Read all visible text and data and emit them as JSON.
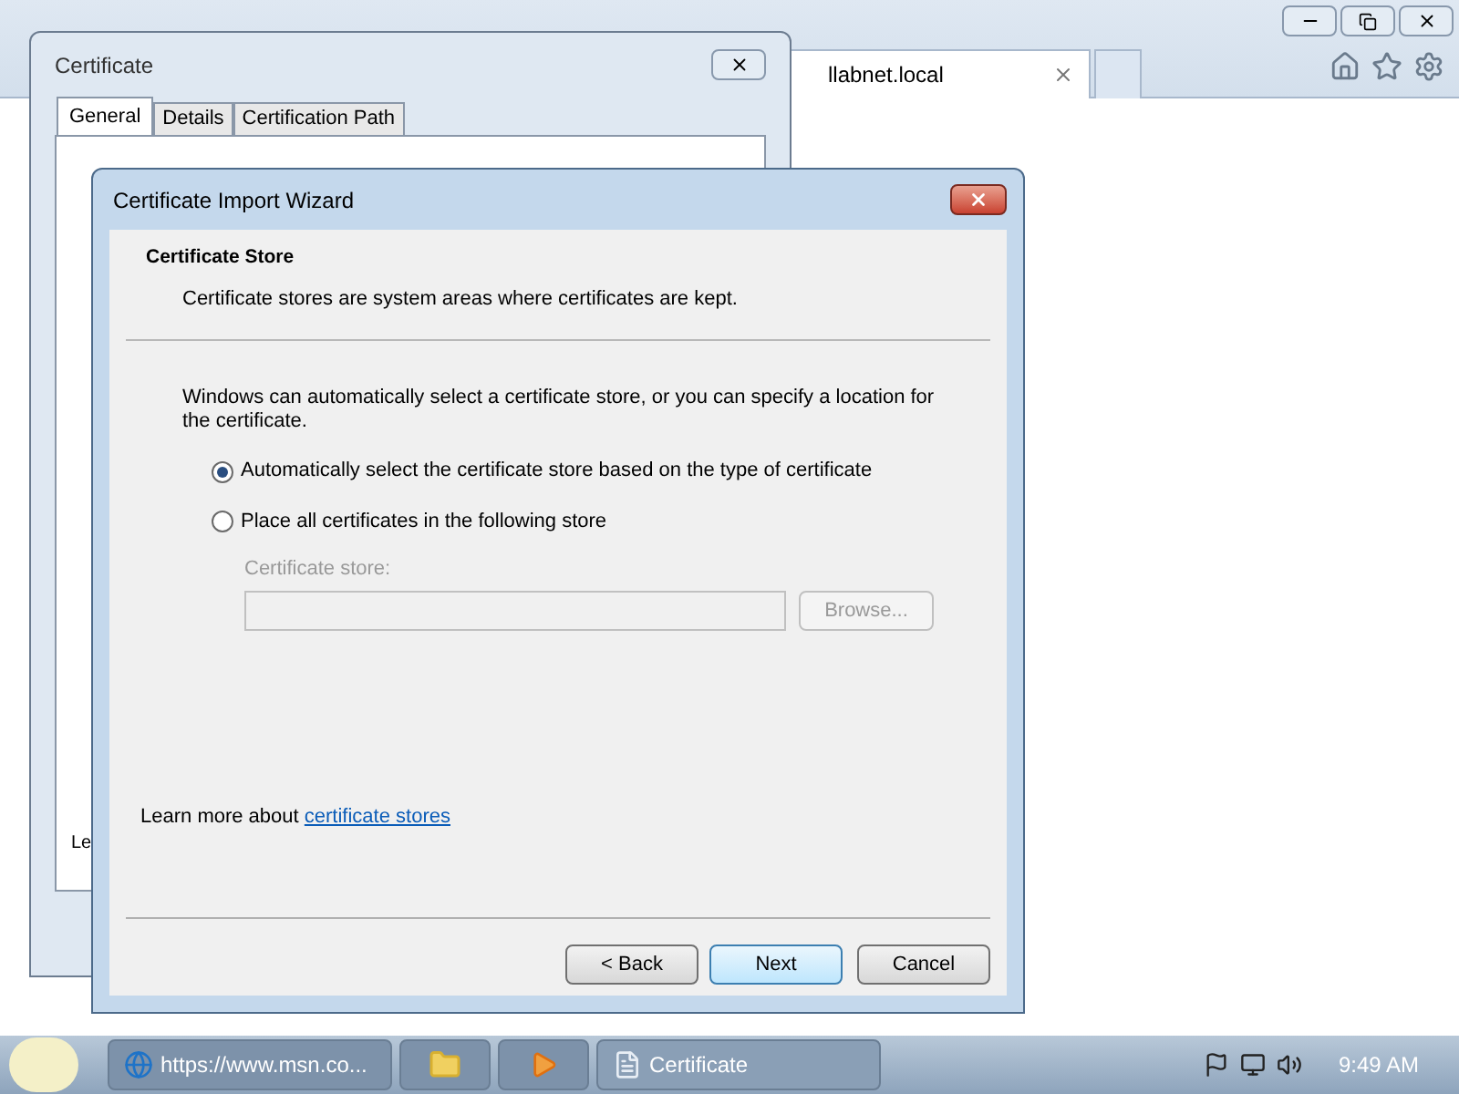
{
  "browser": {
    "tab_title": "llabnet.local"
  },
  "certificate_dialog": {
    "title": "Certificate",
    "tabs": [
      {
        "label": "General",
        "selected": true
      },
      {
        "label": "Details",
        "selected": false
      },
      {
        "label": "Certification Path",
        "selected": false
      }
    ],
    "text": "Le"
  },
  "wizard": {
    "title": "Certificate Import Wizard",
    "heading": "Certificate Store",
    "subheading": "Certificate stores are system areas where certificates are kept.",
    "intro": "Windows can automatically select a certificate store, or you can specify a location for the certificate.",
    "options": [
      {
        "label": "Automatically select the certificate store based on the type of certificate",
        "selected": true
      },
      {
        "label": "Place all certificates in the following store",
        "selected": false
      }
    ],
    "store": {
      "label": "Certificate store:",
      "disabled": true,
      "browse": "Browse..."
    },
    "learn_more": "Learn more about",
    "link": "certificate stores",
    "buttons": [
      {
        "label": "< Back",
        "highlighted": false
      },
      {
        "label": "Next",
        "highlighted": true
      },
      {
        "label": "Cancel",
        "highlighted": false
      }
    ]
  },
  "taskbar": {
    "items": [
      {
        "kind": "browser",
        "label": "https://www.msn.co...",
        "active": false
      },
      {
        "kind": "folder",
        "active": false
      },
      {
        "kind": "media",
        "active": false
      },
      {
        "kind": "document",
        "label": "Certificate",
        "active": true
      }
    ],
    "clock": "9:49 AM"
  }
}
